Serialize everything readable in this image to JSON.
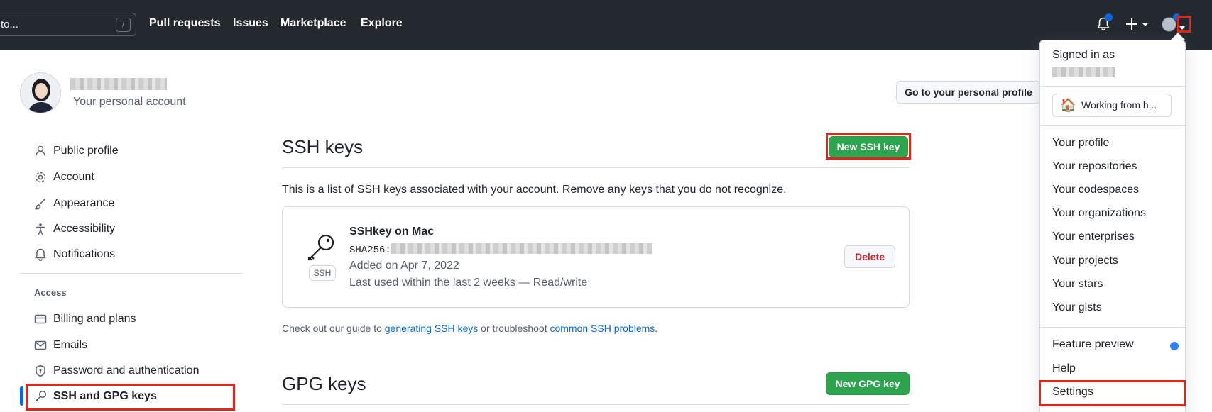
{
  "header": {
    "search_placeholder": "to...",
    "search_shortcut": "/",
    "nav": [
      "Pull requests",
      "Issues",
      "Marketplace",
      "Explore"
    ]
  },
  "profile": {
    "subtitle": "Your personal account",
    "go_to_profile": "Go to your personal profile"
  },
  "sidebar": {
    "items": [
      {
        "label": "Public profile",
        "icon": "person-icon"
      },
      {
        "label": "Account",
        "icon": "gear-icon"
      },
      {
        "label": "Appearance",
        "icon": "paintbrush-icon"
      },
      {
        "label": "Accessibility",
        "icon": "accessibility-icon"
      },
      {
        "label": "Notifications",
        "icon": "bell-icon"
      }
    ],
    "access_heading": "Access",
    "access_items": [
      {
        "label": "Billing and plans",
        "icon": "credit-card-icon"
      },
      {
        "label": "Emails",
        "icon": "mail-icon"
      },
      {
        "label": "Password and authentication",
        "icon": "shield-lock-icon"
      },
      {
        "label": "SSH and GPG keys",
        "icon": "key-icon"
      }
    ]
  },
  "ssh": {
    "title": "SSH keys",
    "new_button": "New SSH key",
    "intro": "This is a list of SSH keys associated with your account. Remove any keys that you do not recognize.",
    "key": {
      "name": "SSHkey on Mac",
      "sha_prefix": "SHA256:",
      "added": "Added on Apr 7, 2022",
      "last_used": "Last used within the last 2 weeks — Read/write",
      "badge": "SSH",
      "delete": "Delete"
    },
    "guide": {
      "before": "Check out our guide to ",
      "link1": "generating SSH keys",
      "middle": " or troubleshoot ",
      "link2": "common SSH problems",
      "after": "."
    }
  },
  "gpg": {
    "title": "GPG keys",
    "new_button": "New GPG key"
  },
  "dropdown": {
    "signed_in": "Signed in as",
    "status": "Working from h...",
    "status_emoji": "🏠",
    "items": [
      "Your profile",
      "Your repositories",
      "Your codespaces",
      "Your organizations",
      "Your enterprises",
      "Your projects",
      "Your stars",
      "Your gists"
    ],
    "feature_preview": "Feature preview",
    "help": "Help",
    "settings": "Settings"
  },
  "colors": {
    "header_bg": "#24292f",
    "primary_green": "#2da44e",
    "link_blue": "#0969da",
    "danger_red": "#cf222e",
    "highlight_red": "#e0261b"
  }
}
